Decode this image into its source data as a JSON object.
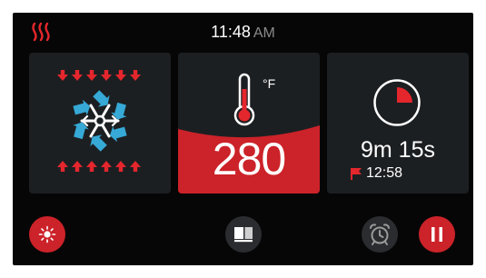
{
  "status_bar": {
    "heat_icon": "heat-waves-icon",
    "time": "11:48",
    "ampm": "AM"
  },
  "fan_panel": {
    "icon": "convection-fan-icon"
  },
  "temperature_panel": {
    "unit": "°F",
    "value": "280",
    "icon": "thermometer-icon"
  },
  "timer_panel": {
    "remaining": "9m 15s",
    "end_time": "12:58",
    "icon": "timer-dial-icon",
    "progress_fraction_elapsed": 0.25
  },
  "bottom_bar": {
    "light_button_icon": "light-icon",
    "view_button_icon": "view-toggle-icon",
    "alarm_button_icon": "alarm-clock-icon",
    "pause_button_icon": "pause-icon"
  },
  "colors": {
    "accent_red": "#cc2229",
    "fan_blue": "#36a9d6",
    "panel_bg": "#1c1f22",
    "screen_bg": "#060606"
  }
}
